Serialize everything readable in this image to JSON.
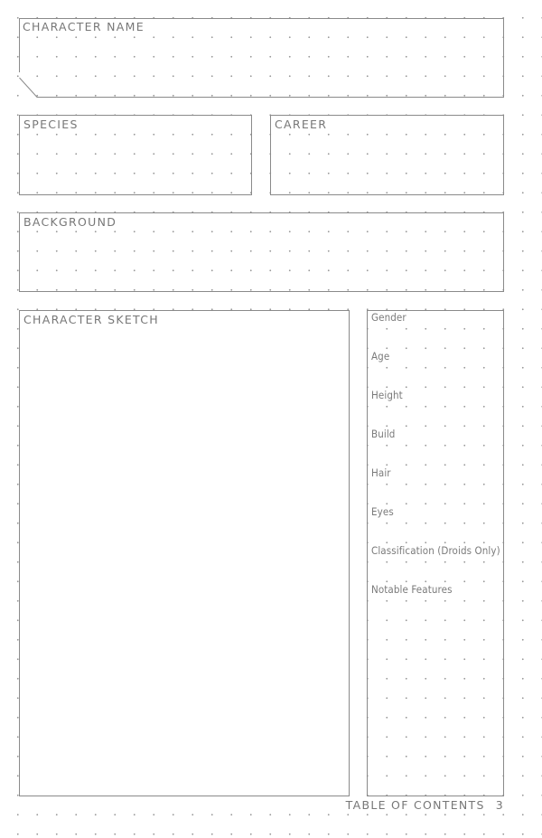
{
  "sections": {
    "character_name": "CHARACTER NAME",
    "species": "SPECIES",
    "career": "CAREER",
    "background": "BACKGROUND",
    "character_sketch": "CHARACTER SKETCH"
  },
  "attributes": [
    "Gender",
    "Age",
    "Height",
    "Build",
    "Hair",
    "Eyes",
    "Classification (Droids Only)",
    "Notable Features"
  ],
  "footer": {
    "text": "TABLE OF CONTENTS",
    "page_number": "3"
  }
}
